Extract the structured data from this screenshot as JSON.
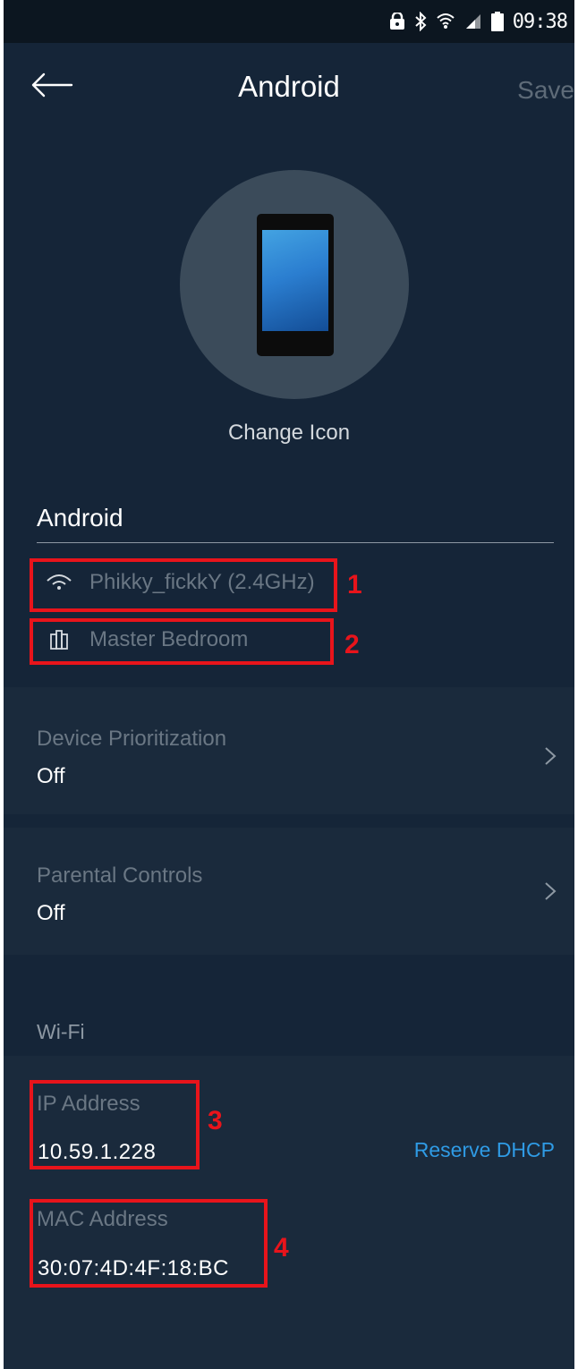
{
  "status_bar": {
    "time": "09:38",
    "icons": [
      "lock-icon",
      "bluetooth-icon",
      "wifi-icon",
      "signal-icon",
      "battery-icon"
    ]
  },
  "header": {
    "title": "Android",
    "save_label": "Save",
    "back_icon": "back-arrow-icon"
  },
  "device": {
    "icon": "smartphone-icon",
    "change_icon_label": "Change Icon",
    "name": "Android",
    "network": "Phikky_fickkY (2.4GHz)",
    "network_icon": "wifi-icon",
    "location": "Master Bedroom",
    "location_icon": "node-icon"
  },
  "annotations": {
    "marker_1": "1",
    "marker_2": "2",
    "marker_3": "3",
    "marker_4": "4",
    "color": "#e8141b"
  },
  "settings": [
    {
      "label": "Device Prioritization",
      "value": "Off"
    },
    {
      "label": "Parental Controls",
      "value": "Off"
    }
  ],
  "wifi": {
    "section_title": "Wi-Fi",
    "ip_label": "IP Address",
    "ip_value": "10.59.1.228",
    "reserve_label": "Reserve DHCP",
    "mac_label": "MAC Address",
    "mac_value": "30:07:4D:4F:18:BC"
  },
  "colors": {
    "background": "#152538",
    "panel": "#1a2a3c",
    "accent": "#2f9be5"
  }
}
